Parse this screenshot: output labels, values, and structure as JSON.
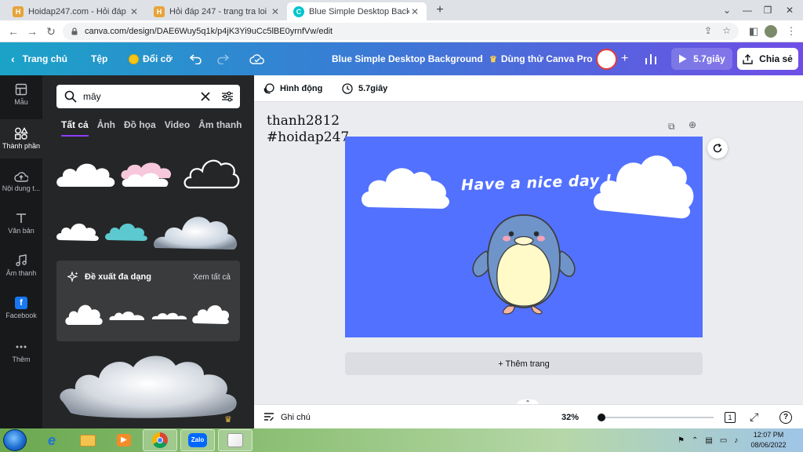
{
  "browser": {
    "tabs": [
      {
        "title": "Hoidap247.com - Hỏi đáp bài tập",
        "favicon_color": "#e8a33a",
        "favicon_letter": "H"
      },
      {
        "title": "Hỏi đáp 247 - trang tra loi",
        "favicon_color": "#e8a33a",
        "favicon_letter": "H"
      },
      {
        "title": "Blue Simple Desktop Background",
        "favicon_color": "#00c4cc",
        "favicon_letter": "C"
      }
    ],
    "url": "canva.com/design/DAE6Wuy5q1k/p4jK3Yi9uCc5lBE0yrnfVw/edit"
  },
  "canva_bar": {
    "home": "Trang chủ",
    "file": "Tệp",
    "resize": "Đổi cỡ",
    "design_title": "Blue Simple Desktop Background",
    "try_pro": "Dùng thử Canva Pro",
    "play_label": "5.7giây",
    "share": "Chia sẻ"
  },
  "rail": {
    "items": [
      {
        "label": "Mẫu",
        "icon": "layout-icon"
      },
      {
        "label": "Thành phần",
        "icon": "elements-icon"
      },
      {
        "label": "Nội dung t...",
        "icon": "upload-cloud-icon"
      },
      {
        "label": "Văn bản",
        "icon": "text-icon"
      },
      {
        "label": "Âm thanh",
        "icon": "music-icon"
      },
      {
        "label": "Facebook",
        "icon": "facebook-icon"
      },
      {
        "label": "Thêm",
        "icon": "more-icon"
      }
    ]
  },
  "panel": {
    "search_value": "mây",
    "tabs": [
      "Tất cả",
      "Ảnh",
      "Đồ họa",
      "Video",
      "Âm thanh"
    ],
    "suggest_title": "Đề xuất đa dạng",
    "suggest_all": "Xem tất cả"
  },
  "editor": {
    "animate": "Hình động",
    "duration": "5.7giây",
    "handwritten_line1": "thanh2812",
    "handwritten_line2": "#hoidap247",
    "canvas_text": "Have a nice day !",
    "canvas_color": "#5271ff",
    "add_page": "+ Thêm trang",
    "notes": "Ghi chú",
    "zoom": "32%",
    "zoom_fraction": 0,
    "page_count": "1"
  },
  "taskbar": {
    "time": "12:07 PM",
    "date": "08/06/2022"
  }
}
